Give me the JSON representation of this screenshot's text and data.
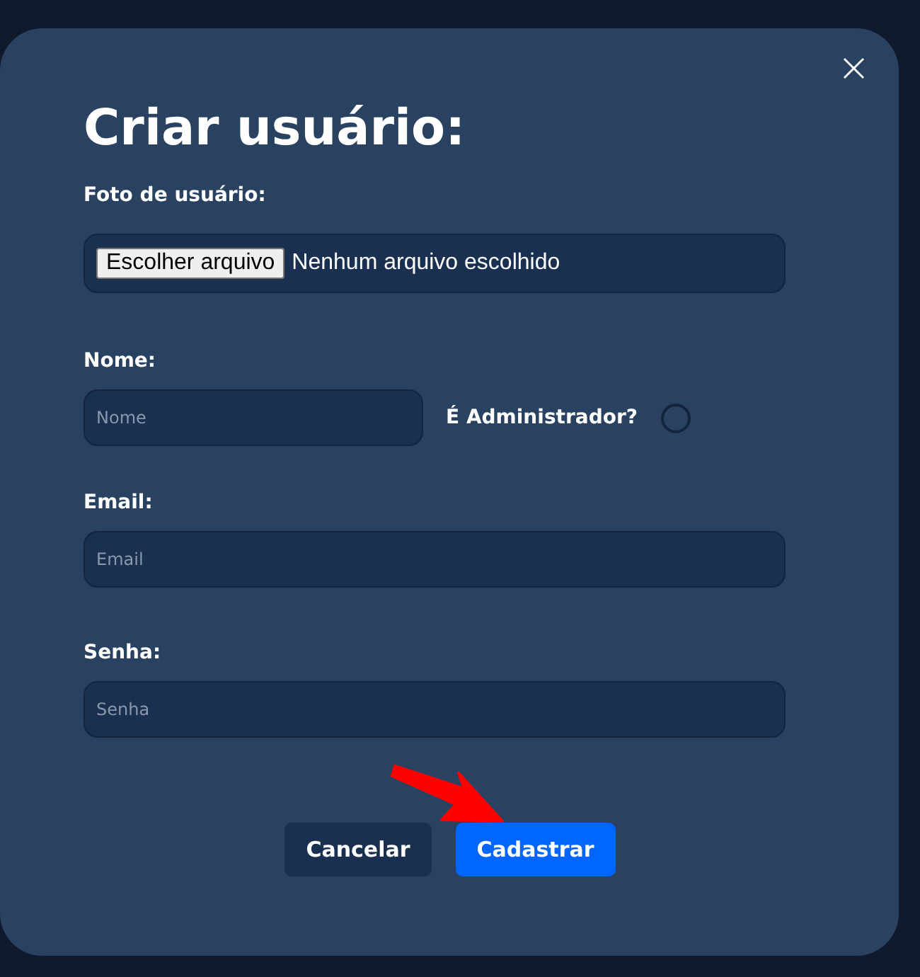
{
  "modal": {
    "title": "Criar usuário:",
    "close": "×",
    "photo": {
      "label": "Foto de usuário:",
      "button": "Escolher arquivo",
      "status": "Nenhum arquivo escolhido"
    },
    "name": {
      "label": "Nome:",
      "placeholder": "Nome"
    },
    "admin": {
      "label": "É Administrador?",
      "checked": false
    },
    "email": {
      "label": "Email:",
      "placeholder": "Email"
    },
    "password": {
      "label": "Senha:",
      "placeholder": "Senha"
    },
    "buttons": [
      {
        "label": "Cancelar",
        "kind": "secondary"
      },
      {
        "label": "Cadastrar",
        "kind": "primary"
      }
    ]
  }
}
